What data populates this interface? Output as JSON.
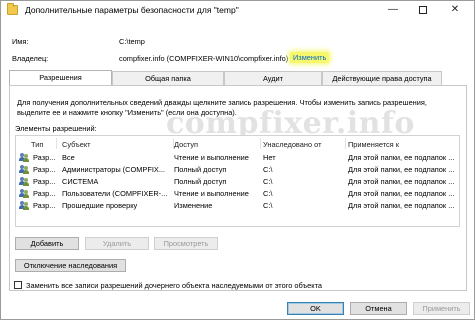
{
  "window": {
    "title": "Дополнительные параметры безопасности  для \"temp\"",
    "minimize": "—",
    "close": "✕"
  },
  "fields": {
    "name_label": "Имя:",
    "name_value": "C:\\temp",
    "owner_label": "Владелец:",
    "owner_value": "compfixer.info (COMPFIXER-WIN10\\compfixer.info)",
    "owner_change_link": "Изменить"
  },
  "tabs": [
    {
      "label": "Разрешения",
      "active": true
    },
    {
      "label": "Общая папка",
      "active": false
    },
    {
      "label": "Аудит",
      "active": false
    },
    {
      "label": "Действующие права доступа",
      "active": false
    }
  ],
  "info_text": "Для получения дополнительных сведений дважды щелкните запись разрешения. Чтобы изменить запись разрешения, выделите ее и нажмите кнопку \"Изменить\" (если она доступна).",
  "watermark": "compfixer.info",
  "table": {
    "caption": "Элементы разрешений:",
    "columns": [
      "Тип",
      "Субъект",
      "Доступ",
      "Унаследовано от",
      "Применяется к"
    ],
    "rows": [
      {
        "icon": "users-icon",
        "type": "Разр...",
        "subject": "Все",
        "access": "Чтение и выполнение",
        "inherited": "Нет",
        "applies": "Для этой папки, ее подпапок ..."
      },
      {
        "icon": "users-icon",
        "type": "Разр...",
        "subject": "Администраторы (COMPFIX...",
        "access": "Полный доступ",
        "inherited": "C:\\",
        "applies": "Для этой папки, ее подпапок ..."
      },
      {
        "icon": "users-icon",
        "type": "Разр...",
        "subject": "СИСТЕМА",
        "access": "Полный доступ",
        "inherited": "C:\\",
        "applies": "Для этой папки, ее подпапок ..."
      },
      {
        "icon": "users-icon",
        "type": "Разр...",
        "subject": "Пользователи (COMPFIXER-...",
        "access": "Чтение и выполнение",
        "inherited": "C:\\",
        "applies": "Для этой папки, ее подпапок ..."
      },
      {
        "icon": "users-icon",
        "type": "Разр...",
        "subject": "Прошедшие проверку",
        "access": "Изменение",
        "inherited": "C:\\",
        "applies": "Для этой папки, ее подпапок ..."
      }
    ]
  },
  "buttons": {
    "add": "Добавить",
    "remove": "Удалить",
    "view": "Просмотреть",
    "disable_inheritance": "Отключение наследования",
    "replace_checkbox_label": "Заменить все записи разрешений дочернего объекта наследуемыми от этого объекта",
    "ok": "OK",
    "cancel": "Отмена",
    "apply": "Применить"
  }
}
